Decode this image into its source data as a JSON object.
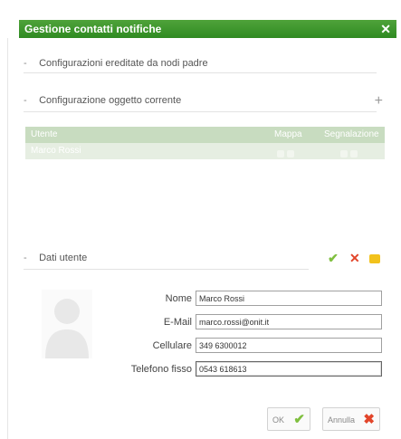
{
  "dialog": {
    "title": "Gestione contatti notifiche",
    "close_glyph": "✕"
  },
  "sections": {
    "inherited_label": "Configurazioni ereditate da nodi padre",
    "current_label": "Configurazione oggetto corrente",
    "user_label": "Dati utente",
    "bullet": "-",
    "add_glyph": "+"
  },
  "grid": {
    "headers": [
      "Utente",
      "Mappa",
      "Segnalazione"
    ],
    "rows": [
      {
        "name": "Marco Rossi"
      }
    ]
  },
  "user_form": {
    "fields": [
      {
        "label": "Nome",
        "value": "Marco Rossi"
      },
      {
        "label": "E-Mail",
        "value": "marco.rossi@onit.it"
      },
      {
        "label": "Cellulare",
        "value": "349 6300012"
      },
      {
        "label": "Telefono fisso",
        "value": "0543 618613"
      }
    ]
  },
  "actions": {
    "confirm_glyph": "✔",
    "cancel_glyph": "✕"
  },
  "buttons": {
    "ok_label": "OK",
    "ok_glyph": "✔",
    "cancel_label": "Annulla",
    "cancel_glyph": "✖"
  },
  "colors": {
    "title_bar": "#3a9a2c",
    "grid_header": "#c8dcc0",
    "grid_row": "#e6eee2",
    "confirm": "#7fbf3f",
    "cancel": "#e2452a",
    "lock": "#f2c21c"
  },
  "icons": {
    "close": "close-icon",
    "add": "plus-icon",
    "confirm": "check-icon",
    "cancel": "cross-icon",
    "lock": "lock-icon",
    "avatar": "user-silhouette-icon"
  }
}
